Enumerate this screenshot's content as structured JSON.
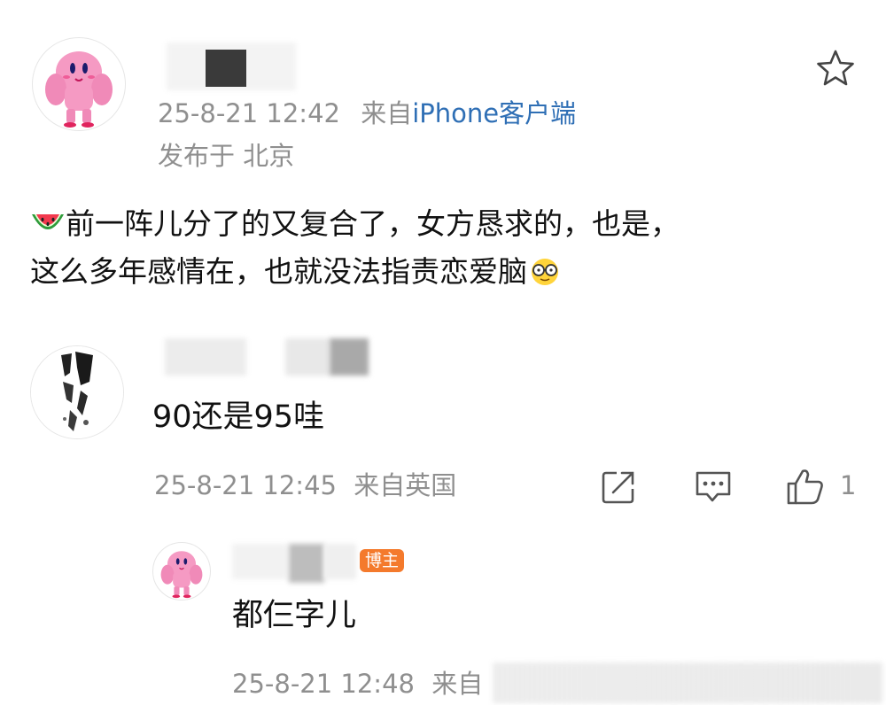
{
  "post": {
    "author_avatar": "muscle-kirby-avatar",
    "timestamp": "25-8-21 12:42",
    "source_prefix": "来自",
    "source_client": "iPhone客户端",
    "location": "发布于 北京",
    "content_emoji": "watermelon-emoji",
    "content_line1": "前一阵儿分了的又复合了，女方恳求的，也是，",
    "content_line2": "这么多年感情在，也就没法指责恋爱脑",
    "content_end_emoji": "glasses-face-emoji",
    "favorite_icon": "star-icon"
  },
  "comment": {
    "avatar": "ink-wash-avatar",
    "text": "90还是95哇",
    "timestamp": "25-8-21 12:45",
    "source": "来自英国",
    "share_icon": "share-icon",
    "reply_icon": "comment-icon",
    "like_icon": "thumbs-up-icon",
    "like_count": "1"
  },
  "reply": {
    "avatar": "muscle-kirby-avatar",
    "badge": "博主",
    "text": "都仨字儿",
    "timestamp": "25-8-21 12:48",
    "source": "来自"
  },
  "colors": {
    "link_blue": "#2f6fb5",
    "meta_gray": "#8f8f8f",
    "badge_orange": "#f47a2c",
    "kirby_pink": "#f59ac3"
  }
}
